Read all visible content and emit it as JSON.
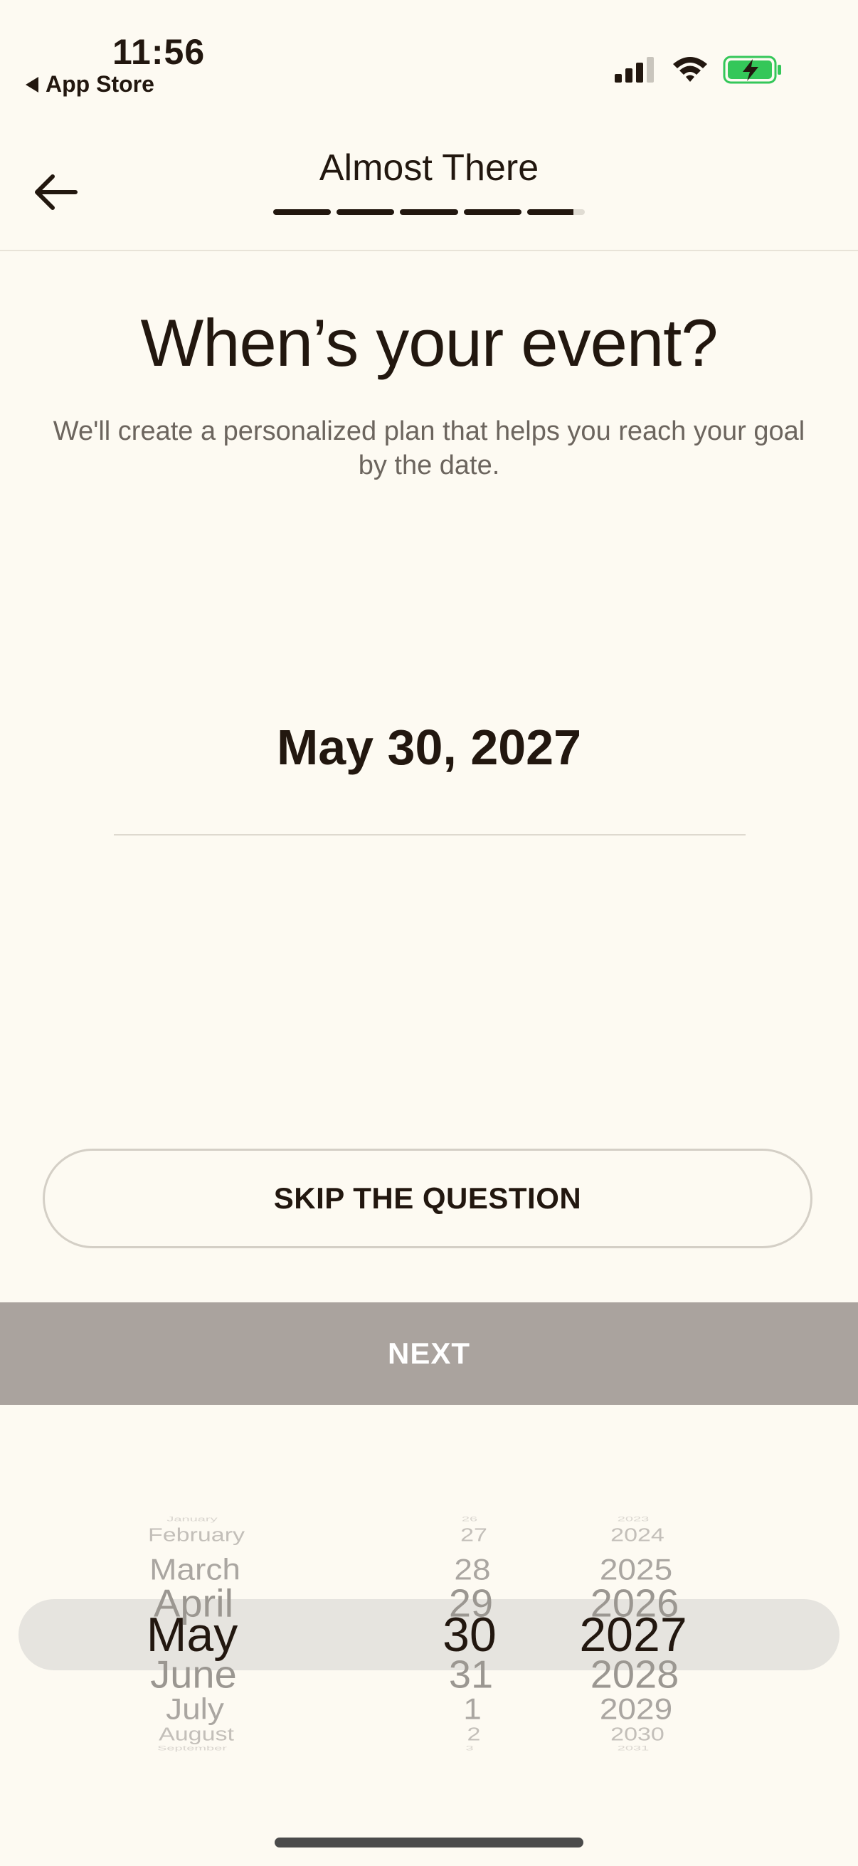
{
  "status_bar": {
    "time": "11:56",
    "back_app_label": "App Store",
    "battery_color": "#34c759"
  },
  "header": {
    "title": "Almost There",
    "progress_total_steps": 5,
    "progress_completed_fraction": 0.96
  },
  "content": {
    "headline": "When’s your event?",
    "subtext": "We'll create a personalized plan that helps you reach your goal by the date.",
    "selected_date": "May 30, 2027"
  },
  "actions": {
    "skip_label": "SKIP THE QUESTION",
    "next_label": "NEXT"
  },
  "picker": {
    "months": [
      "January",
      "February",
      "March",
      "April",
      "May",
      "June",
      "July",
      "August",
      "September"
    ],
    "days": [
      "26",
      "27",
      "28",
      "29",
      "30",
      "31",
      "1",
      "2",
      "3"
    ],
    "years": [
      "2023",
      "2024",
      "2025",
      "2026",
      "2027",
      "2028",
      "2029",
      "2030",
      "2031"
    ],
    "selected_index": 4
  }
}
